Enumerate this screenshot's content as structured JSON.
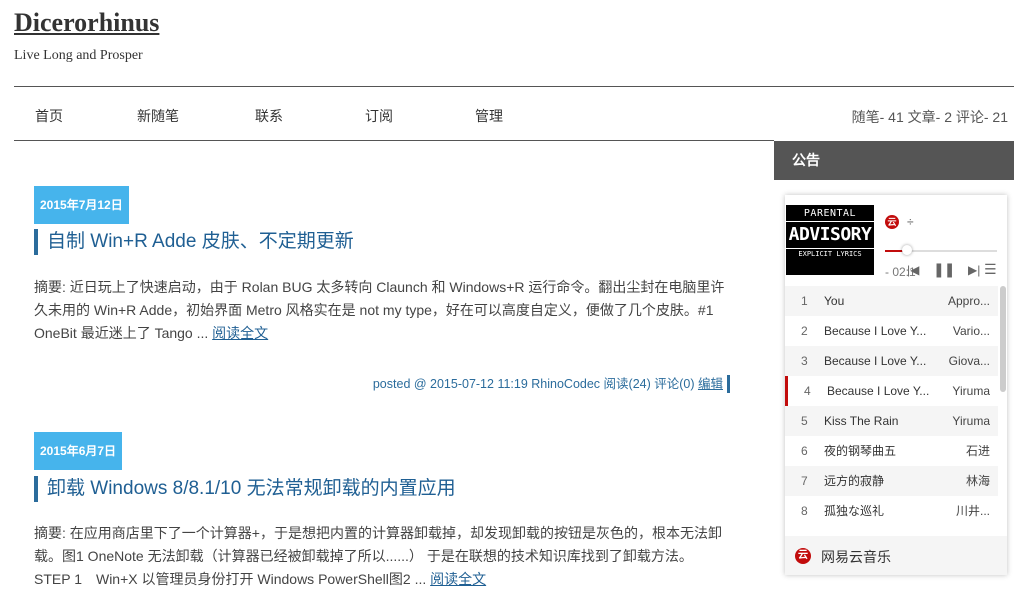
{
  "site": {
    "title": "Dicerorhinus",
    "subtitle": "Live Long and Prosper"
  },
  "nav": {
    "items": [
      "首页",
      "新随笔",
      "联系",
      "订阅",
      "管理"
    ],
    "stats": "随笔- 41  文章- 2  评论- 21"
  },
  "posts": [
    {
      "date": "2015年7月12日",
      "title": "自制 Win+R Adde 皮肤、不定期更新",
      "summary": "摘要: 近日玩上了快速启动，由于 Rolan BUG 太多转向 Claunch 和 Windows+R 运行命令。翻出尘封在电脑里许久未用的 Win+R Adde，初始界面 Metro 风格实在是 not my type，好在可以高度自定义，便做了几个皮肤。#1 OneBit 最近迷上了 Tango ... ",
      "read_more": "阅读全文",
      "meta": "posted @ 2015-07-12 11:19 RhinoCodec 阅读(24) 评论(0) ",
      "edit": "编辑"
    },
    {
      "date": "2015年6月7日",
      "title": "卸载 Windows 8/8.1/10 无法常规卸载的内置应用",
      "summary": "摘要: 在应用商店里下了一个计算器+，于是想把内置的计算器卸载掉，却发现卸载的按钮是灰色的，根本无法卸载。图1 OneNote 无法卸载（计算器已经被卸载掉了所以......） 于是在联想的技术知识库找到了卸载方法。STEP 1　Win+X 以管理员身份打开 Windows PowerShell图2 ... ",
      "read_more": "阅读全文"
    }
  ],
  "sidebar": {
    "header": "公告",
    "player": {
      "album_text": {
        "top": "PARENTAL",
        "mid": "ADVISORY",
        "bottom": "EXPLICIT LYRICS"
      },
      "logo_glyph": "云",
      "now_title": "÷",
      "time": "- 02:1",
      "progress_fraction": 0.17,
      "controls": {
        "prev": "|◀",
        "pause": "❚❚",
        "next": "▶|",
        "list": "☰"
      },
      "tracks": [
        {
          "num": "1",
          "song": "You",
          "artist": "Appro..."
        },
        {
          "num": "2",
          "song": "Because I Love Y...",
          "artist": "Vario..."
        },
        {
          "num": "3",
          "song": "Because I Love Y...",
          "artist": "Giova..."
        },
        {
          "num": "4",
          "song": "Because I Love Y...",
          "artist": "Yiruma"
        },
        {
          "num": "5",
          "song": "Kiss The Rain",
          "artist": "Yiruma"
        },
        {
          "num": "6",
          "song": "夜的钢琴曲五",
          "artist": "石进"
        },
        {
          "num": "7",
          "song": "远方的寂静",
          "artist": "林海"
        },
        {
          "num": "8",
          "song": "孤独な巡礼",
          "artist": "川井..."
        }
      ],
      "active_track": 4,
      "footer_label": "网易云音乐"
    }
  }
}
